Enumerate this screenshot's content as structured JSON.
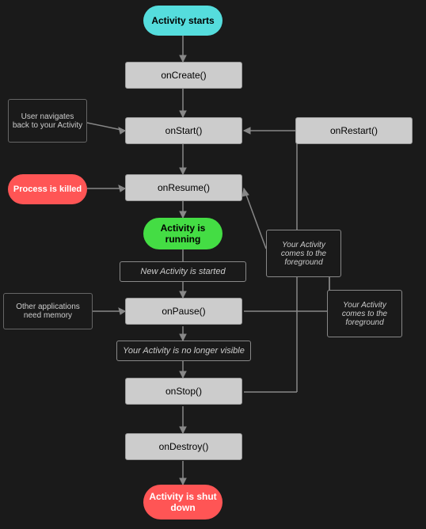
{
  "nodes": {
    "activity_starts": "Activity starts",
    "onCreate": "onCreate()",
    "onStart": "onStart()",
    "onRestart": "onRestart()",
    "onResume": "onResume()",
    "activity_running": "Activity is running",
    "new_activity_started": "New Activity is started",
    "onPause": "onPause()",
    "no_longer_visible": "Your Activity is no longer visible",
    "onStop": "onStop()",
    "onDestroy": "onDestroy()",
    "activity_shutdown": "Activity is shut down",
    "user_navigates_back": "User navigates back to your Activity",
    "process_killed": "Process is killed",
    "other_apps_memory": "Other applications need memory",
    "activity_comes_foreground_1": "Your Activity comes to the foreground",
    "activity_comes_foreground_2": "Your Activity comes to the foreground"
  }
}
